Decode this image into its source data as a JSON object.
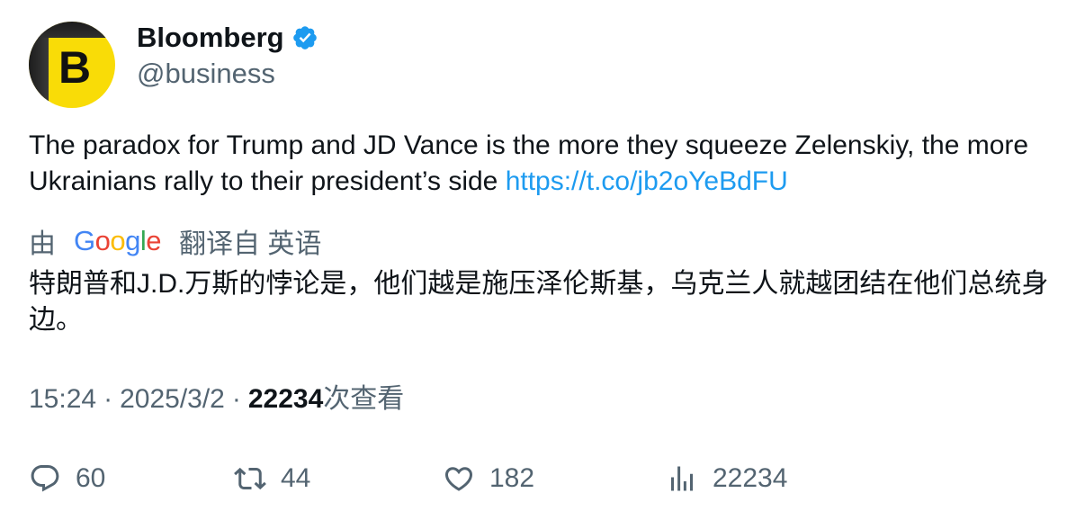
{
  "author": {
    "avatar_letter": "B",
    "display_name": "Bloomberg",
    "handle": "@business",
    "verified": true,
    "avatar_colors": {
      "background": "#f9dc07",
      "accent": "#1c1c1c"
    }
  },
  "tweet": {
    "text": "The paradox for Trump and JD Vance is the more they squeeze Zelenskiy, the more Ukrainians rally to their president’s side ",
    "link": "https://t.co/jb2oYeBdFU"
  },
  "translation": {
    "prefix": "由",
    "provider": "Google",
    "suffix": "翻译自 英语",
    "text": "特朗普和J.D.万斯的悖论是，他们越是施压泽伦斯基，乌克兰人就越团结在他们总统身边。"
  },
  "meta": {
    "time": "15:24",
    "separator": "·",
    "date": "2025/3/2",
    "views_count": "22234",
    "views_label": "次查看"
  },
  "actions": {
    "reply": {
      "icon": "reply-icon",
      "count": "60"
    },
    "retweet": {
      "icon": "retweet-icon",
      "count": "44"
    },
    "like": {
      "icon": "heart-icon",
      "count": "182"
    },
    "views": {
      "icon": "analytics-icon",
      "count": "22234"
    }
  },
  "colors": {
    "link": "#1d9bf0",
    "secondary_text": "#536471",
    "primary_text": "#0f1419",
    "verified_badge": "#1d9bf0"
  }
}
